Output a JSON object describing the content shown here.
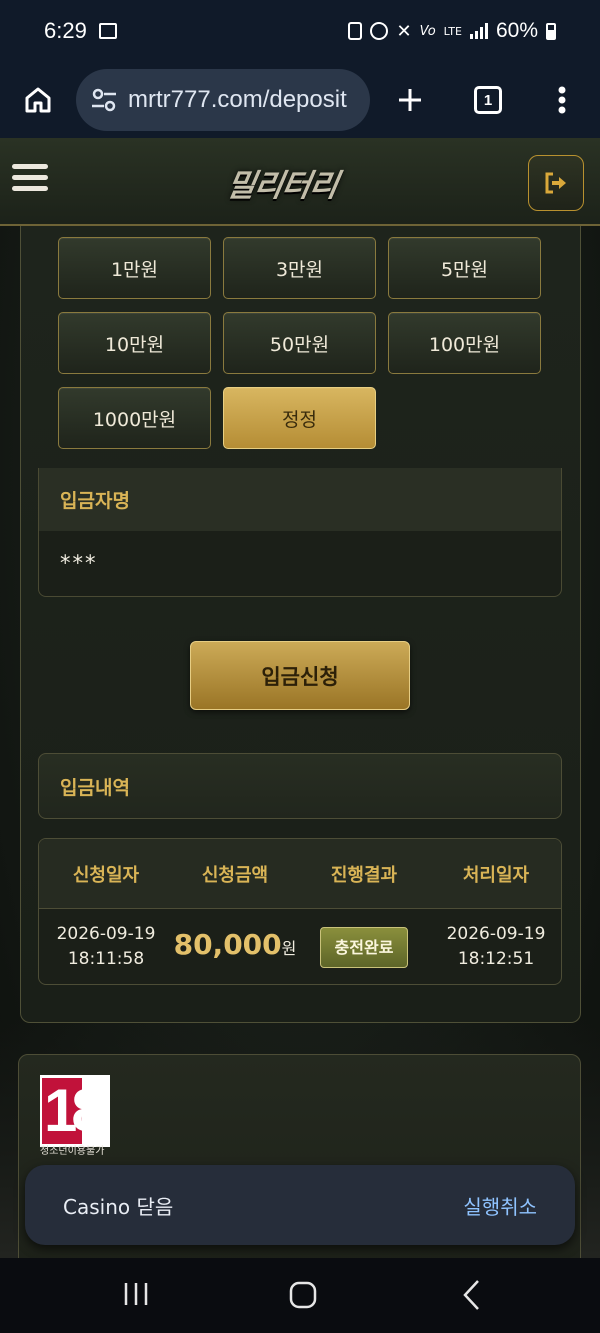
{
  "status_bar": {
    "time": "6:29",
    "lte": "LTE",
    "volte": "Vo",
    "battery_pct": "60%"
  },
  "chrome": {
    "url": "mrtr777.com/deposit",
    "tab_count": "1"
  },
  "site": {
    "logo_text": "밀리터리"
  },
  "amount_buttons": [
    "1만원",
    "3만원",
    "5만원",
    "10만원",
    "50만원",
    "100만원",
    "1000만원"
  ],
  "reset_label": "정정",
  "depositor": {
    "label": "입금자명",
    "value": "***"
  },
  "submit_label": "입금신청",
  "history": {
    "title": "입금내역",
    "columns": [
      "신청일자",
      "신청금액",
      "진행결과",
      "처리일자"
    ],
    "rows": [
      {
        "request_date": "2026-09-19",
        "request_time": "18:11:58",
        "amount": "80,000",
        "unit": "원",
        "status": "충전완료",
        "processed_date": "2026-09-19",
        "processed_time": "18:12:51"
      }
    ]
  },
  "footer": {
    "age_number": "18",
    "age_label": "청소년이용불가"
  },
  "snackbar": {
    "message": "Casino 닫음",
    "action": "실행취소"
  },
  "colors": {
    "accent_gold": "#d9b456",
    "browser_bar": "#101a29",
    "status_badge": "#6f7730"
  }
}
